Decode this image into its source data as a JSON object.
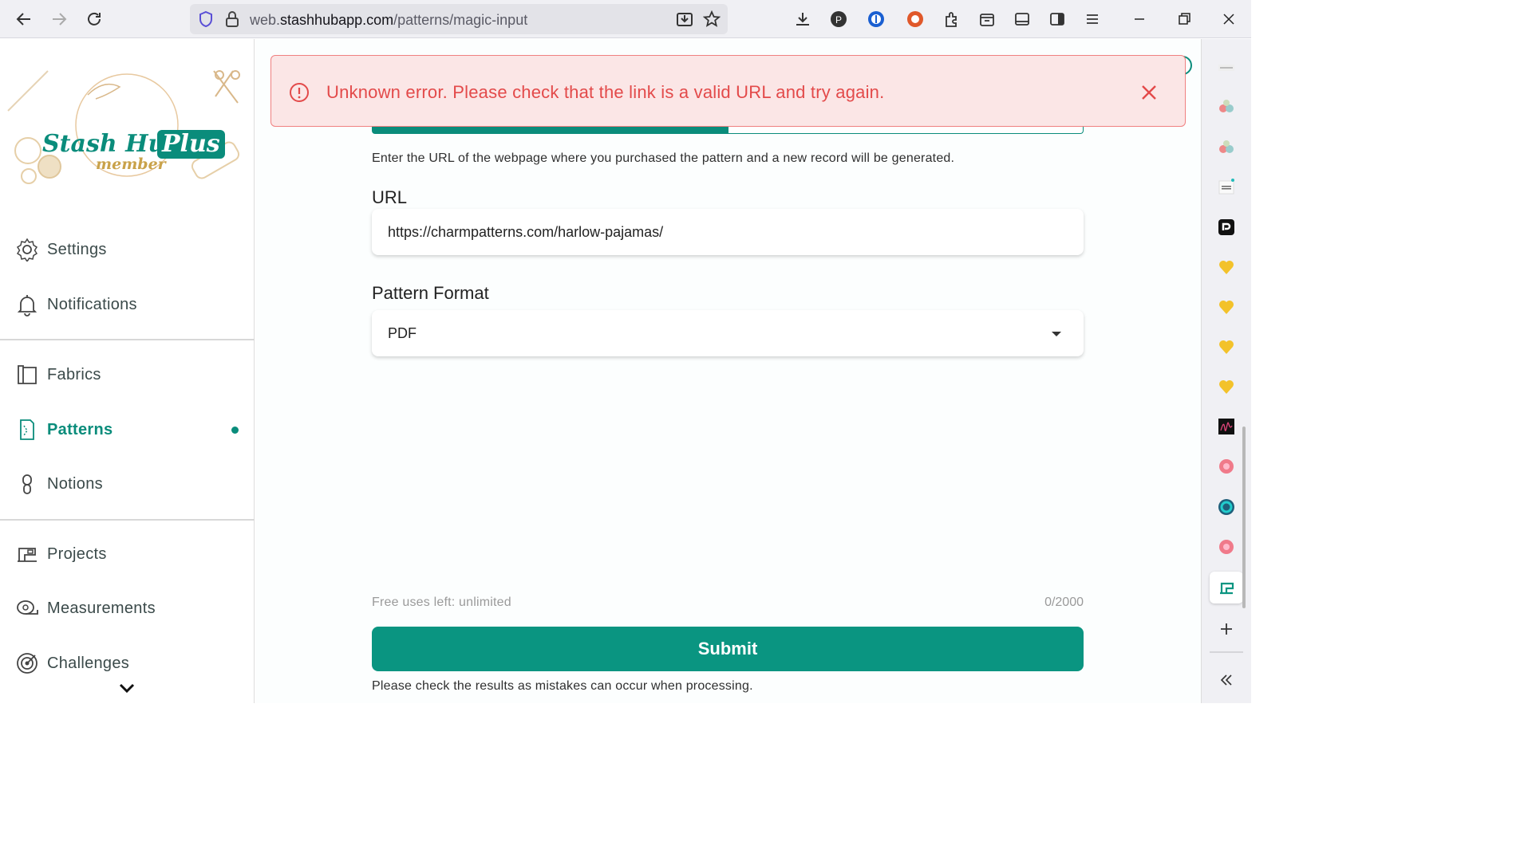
{
  "browser": {
    "url_prefix": "web.",
    "url_domain": "stashhubapp.com",
    "url_path": "/patterns/magic-input"
  },
  "logo": {
    "title": "Stash Hub",
    "plus": "Plus",
    "subtitle": "member"
  },
  "sidebar": {
    "items": [
      {
        "label": "Settings",
        "icon": "gear-icon"
      },
      {
        "label": "Notifications",
        "icon": "bell-icon"
      },
      {
        "label": "Fabrics",
        "icon": "fabric-icon"
      },
      {
        "label": "Patterns",
        "icon": "pattern-icon",
        "active": true
      },
      {
        "label": "Notions",
        "icon": "zipper-icon"
      },
      {
        "label": "Projects",
        "icon": "sewing-machine-icon"
      },
      {
        "label": "Measurements",
        "icon": "tape-measure-icon"
      },
      {
        "label": "Challenges",
        "icon": "target-icon"
      }
    ]
  },
  "alert": {
    "message": "Unknown error. Please check that the link is a valid URL and try again."
  },
  "form": {
    "description": "Enter the URL of the webpage where you purchased the pattern and a new record will be generated.",
    "url_label": "URL",
    "url_value": "https://charmpatterns.com/harlow-pajamas/",
    "format_label": "Pattern Format",
    "format_value": "PDF",
    "free_uses": "Free uses left: unlimited",
    "char_count": "0/2000",
    "submit_label": "Submit",
    "note": "Please check the results as mistakes can occur when processing."
  },
  "colors": {
    "accent": "#0a8c7b",
    "error": "#e34a4a",
    "error_bg": "#fbe6e6"
  }
}
